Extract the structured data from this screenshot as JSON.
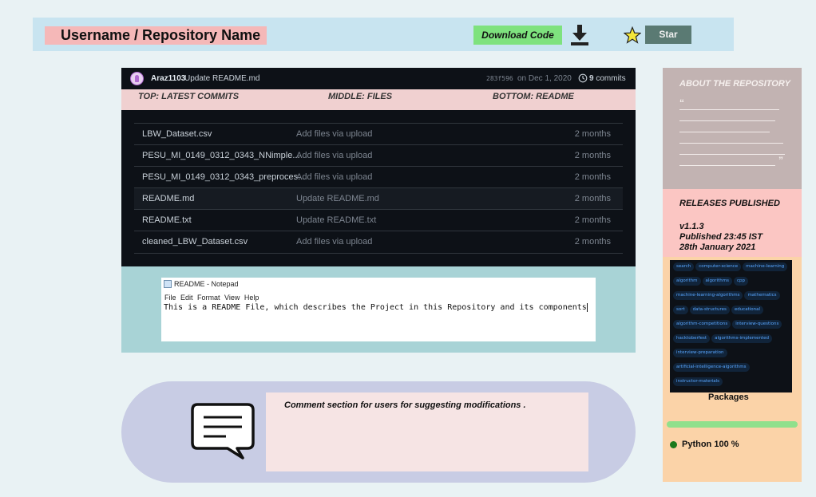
{
  "header": {
    "repo_title": "Username  / Repository Name",
    "download_label": "Download Code",
    "star_label": "Star"
  },
  "commit": {
    "author": "Araz1103",
    "message": "Update README.md",
    "hash": "283f596",
    "date": "on Dec 1, 2020",
    "count_number": "9",
    "count_label": "commits"
  },
  "sections": {
    "top": "TOP: LATEST COMMITS",
    "middle": "MIDDLE: FILES",
    "bottom": "BOTTOM: README"
  },
  "files": [
    {
      "name": "LBW_Dataset.csv",
      "message": "Add files via upload",
      "age": "2 months"
    },
    {
      "name": "PESU_MI_0149_0312_0343_NNimple...",
      "message": "Add files via upload",
      "age": "2 months"
    },
    {
      "name": "PESU_MI_0149_0312_0343_preproces...",
      "message": "Add files via upload",
      "age": "2 months"
    },
    {
      "name": "README.md",
      "message": "Update README.md",
      "age": "2 months"
    },
    {
      "name": "README.txt",
      "message": "Update README.txt",
      "age": "2 months"
    },
    {
      "name": "cleaned_LBW_Dataset.csv",
      "message": "Add files via upload",
      "age": "2 months"
    }
  ],
  "notepad": {
    "title": "README - Notepad",
    "menu": "File Edit Format View Help",
    "content": "This is a README File, which describes the Project in this Repository and its components"
  },
  "comments": {
    "text": "Comment section for users  for suggesting  modifications ."
  },
  "sidebar": {
    "about_title": "ABOUT THE REPOSITORY",
    "open_quote": "“",
    "close_quote": "”",
    "releases_title": "RELEASES PUBLISHED",
    "release_version": "v1.1.3",
    "release_time": "Published 23:45 IST",
    "release_date": "28th January 2021",
    "topics": [
      "search",
      "computer-science",
      "machine-learning",
      "algorithm",
      "algorithms",
      "cpp",
      "machine-learning-algorithms",
      "mathematics",
      "sort",
      "data-structures",
      "educational",
      "algorithm-competitions",
      "interview-questions",
      "hacktoberfest",
      "algorithms-implemented",
      "interview-preparation",
      "artificial-intelligence-algorithms",
      "instructor-materials"
    ],
    "packages_label": "Packages",
    "language_label": "Python 100 %",
    "language_percent": 100
  },
  "colors": {
    "header_bg": "#c8e4f0",
    "download_bg": "#7ee27e",
    "star_bg": "#5a7a73",
    "panel_dark": "#0d1117",
    "readme_bg": "#a8d3d6",
    "comment_bg": "#c8cce4",
    "about_bg": "#c2b3b2",
    "releases_bg": "#fbc6c3",
    "lower_bg": "#fbd3a8",
    "language_color": "#1c7a1c"
  },
  "icons": {
    "download": "download-icon",
    "star": "star-icon",
    "history": "history-icon",
    "comment": "speech-bubble-icon"
  }
}
